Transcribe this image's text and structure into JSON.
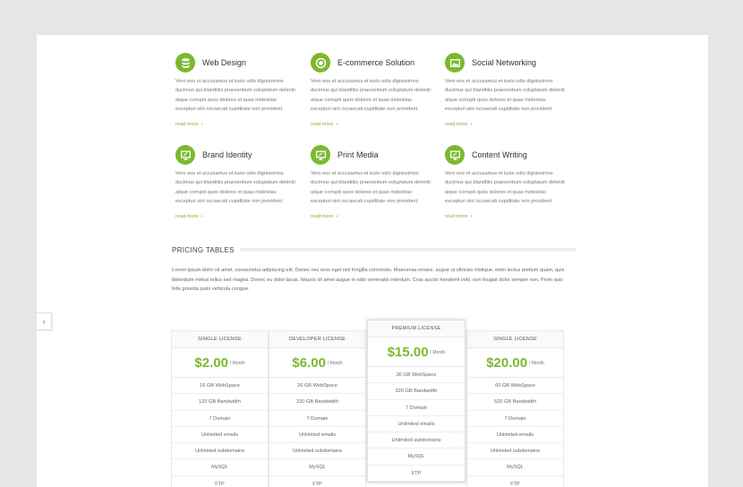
{
  "services": [
    {
      "title": "Web Design",
      "icon": "database-icon",
      "text": "Vero eos et accusamus et iusto odio dignissimos ducimus qui blanditiis praesentium voluptatum deleniti atque corrupti quos dolores et quas molestias excepturi sint occaecati cupiditate non provident.",
      "more": "read more"
    },
    {
      "title": "E-commerce Solution",
      "icon": "target-icon",
      "text": "Vero eos et accusamus et iusto odio dignissimos ducimus qui blanditiis praesentium voluptatum deleniti atque corrupti quos dolores et quas molestias excepturi sint occaecati cupiditate non provident.",
      "more": "read more"
    },
    {
      "title": "Social Networking",
      "icon": "image-icon",
      "text": "Vero eos et accusamus et iusto odio dignissimos ducimus qui blanditiis praesentium voluptatum deleniti atque corrupti quos dolores et quas molestias excepturi sint occaecati cupiditate non provident.",
      "more": "read more"
    },
    {
      "title": "Brand Identity",
      "icon": "monitor-icon",
      "text": "Vero eos et accusamus et iusto odio dignissimos ducimus qui blanditiis praesentium voluptatum deleniti atque corrupti quos dolores et quas molestias excepturi sint occaecati cupiditate non provident.",
      "more": "read more"
    },
    {
      "title": "Print Media",
      "icon": "monitor-icon",
      "text": "Vero eos et accusamus et iusto odio dignissimos ducimus qui blanditiis praesentium voluptatum deleniti atque corrupti quos dolores et quas molestias excepturi sint occaecati cupiditate non provident.",
      "more": "read more"
    },
    {
      "title": "Content Writing",
      "icon": "monitor-icon",
      "text": "Vero eos et accusamus et iusto odio dignissimos ducimus qui blanditiis praesentium voluptatum deleniti atque corrupti quos dolores et quas molestias excepturi sint occaecati cupiditate non provident.",
      "more": "read more"
    }
  ],
  "pricing": {
    "title": "PRICING TABLES",
    "intro": "Lorem ipsum dolor sit amet, consectetur adipiscing elit. Donec nec eros eget nisl fringilla commodo. Maecenas ornare, augue ut ultricies tristique, enim lectus pretium quam, quis bibendum metus tellus sed magna. Donec eu dolor lacus. Mauris sit amet augue in odio venenatis interdum. Cras auctor hendrerit velit, non feugiat dolor semper non. Proin quis felis gravida justo vehicula congue.",
    "plans": [
      {
        "name": "SINGLE LICENSE",
        "price": "$2.00",
        "period": "/ Month",
        "featured": false,
        "features": [
          "16 GB WebSpace",
          "120 GB Bandwidth",
          "7 Domain",
          "Unlimited emails",
          "Unlimited subdomains",
          "MySQL",
          "FTP"
        ]
      },
      {
        "name": "DEVELOPER LICENSE",
        "price": "$6.00",
        "period": "/ Month",
        "featured": false,
        "features": [
          "26 GB WebSpace",
          "220 GB Bandwidth",
          "7 Domain",
          "Unlimited emails",
          "Unlimited subdomains",
          "MySQL",
          "FTP"
        ]
      },
      {
        "name": "PREMIUM LICENSE",
        "price": "$15.00",
        "period": "/ Month",
        "featured": true,
        "features": [
          "36 GB WebSpace",
          "320 GB Bandwidth",
          "7 Domain",
          "Unlimited emails",
          "Unlimited subdomains",
          "MySQL",
          "FTP"
        ]
      },
      {
        "name": "SINGLE LICENSE",
        "price": "$20.00",
        "period": "/ Month",
        "featured": false,
        "features": [
          "60 GB WebSpace",
          "520 GB Bandwidth",
          "7 Domain",
          "Unlimited emails",
          "Unlimited subdomains",
          "MySQL",
          "FTP"
        ]
      }
    ]
  },
  "side_tab": {
    "icon": "chevron-right-icon",
    "glyph": "›"
  },
  "colors": {
    "accent": "#7cb82f",
    "background": "#e6e6e6",
    "panel": "#ffffff"
  }
}
